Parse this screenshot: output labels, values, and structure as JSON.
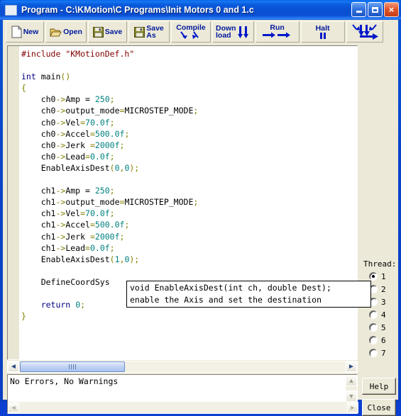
{
  "window": {
    "title": "Program - C:\\KMotion\\C Programs\\Init Motors 0 and 1.c",
    "icon": "document-icon",
    "caption": {
      "minimize": "minimize-icon",
      "maximize": "maximize-icon",
      "close": "×"
    }
  },
  "toolbar": {
    "buttons": [
      {
        "name": "new",
        "label": "New",
        "icon": "page-icon"
      },
      {
        "name": "open",
        "label": "Open",
        "icon": "folder-open-icon"
      },
      {
        "name": "save",
        "label": "Save",
        "icon": "floppy-icon"
      },
      {
        "name": "save-as",
        "label": "Save\nAs",
        "icon": "floppy-icon"
      },
      {
        "name": "compile",
        "label": "Compile",
        "icon": "two-arrows-down-icon"
      },
      {
        "name": "download",
        "label": "Down\nload",
        "icon": "arrow-down-icon"
      },
      {
        "name": "run",
        "label": "Run",
        "icon": "two-arrows-right-icon"
      },
      {
        "name": "halt",
        "label": "Halt",
        "icon": "pause-icon"
      },
      {
        "name": "compile-download-run",
        "label": "",
        "icon": "compile-download-run-icon"
      }
    ]
  },
  "editor": {
    "lines": [
      [
        {
          "t": "#include ",
          "c": "pre"
        },
        {
          "t": "\"KMotionDef.h\"",
          "c": "str"
        }
      ],
      [
        {
          "t": "",
          "c": "pln"
        }
      ],
      [
        {
          "t": "int",
          "c": "kw"
        },
        {
          "t": " main",
          "c": "pln"
        },
        {
          "t": "()",
          "c": "op"
        }
      ],
      [
        {
          "t": "{",
          "c": "op"
        }
      ],
      [
        {
          "t": "    ch0",
          "c": "pln"
        },
        {
          "t": "->",
          "c": "op"
        },
        {
          "t": "Amp = ",
          "c": "pln"
        },
        {
          "t": "250",
          "c": "num"
        },
        {
          "t": ";",
          "c": "op"
        }
      ],
      [
        {
          "t": "    ch0",
          "c": "pln"
        },
        {
          "t": "->",
          "c": "op"
        },
        {
          "t": "output_mode",
          "c": "pln"
        },
        {
          "t": "=",
          "c": "op"
        },
        {
          "t": "MICROSTEP_MODE",
          "c": "pln"
        },
        {
          "t": ";",
          "c": "op"
        }
      ],
      [
        {
          "t": "    ch0",
          "c": "pln"
        },
        {
          "t": "->",
          "c": "op"
        },
        {
          "t": "Vel",
          "c": "pln"
        },
        {
          "t": "=",
          "c": "op"
        },
        {
          "t": "70.0f",
          "c": "num"
        },
        {
          "t": ";",
          "c": "op"
        }
      ],
      [
        {
          "t": "    ch0",
          "c": "pln"
        },
        {
          "t": "->",
          "c": "op"
        },
        {
          "t": "Accel",
          "c": "pln"
        },
        {
          "t": "=",
          "c": "op"
        },
        {
          "t": "500.0f",
          "c": "num"
        },
        {
          "t": ";",
          "c": "op"
        }
      ],
      [
        {
          "t": "    ch0",
          "c": "pln"
        },
        {
          "t": "->",
          "c": "op"
        },
        {
          "t": "Jerk ",
          "c": "pln"
        },
        {
          "t": "=",
          "c": "op"
        },
        {
          "t": "2000f",
          "c": "num"
        },
        {
          "t": ";",
          "c": "op"
        }
      ],
      [
        {
          "t": "    ch0",
          "c": "pln"
        },
        {
          "t": "->",
          "c": "op"
        },
        {
          "t": "Lead",
          "c": "pln"
        },
        {
          "t": "=",
          "c": "op"
        },
        {
          "t": "0.0f",
          "c": "num"
        },
        {
          "t": ";",
          "c": "op"
        }
      ],
      [
        {
          "t": "    EnableAxisDest",
          "c": "pln"
        },
        {
          "t": "(",
          "c": "op"
        },
        {
          "t": "0",
          "c": "num"
        },
        {
          "t": ",",
          "c": "op"
        },
        {
          "t": "0",
          "c": "num"
        },
        {
          "t": ");",
          "c": "op"
        }
      ],
      [
        {
          "t": "",
          "c": "pln"
        }
      ],
      [
        {
          "t": "    ch1",
          "c": "pln"
        },
        {
          "t": "->",
          "c": "op"
        },
        {
          "t": "Amp = ",
          "c": "pln"
        },
        {
          "t": "250",
          "c": "num"
        },
        {
          "t": ";",
          "c": "op"
        }
      ],
      [
        {
          "t": "    ch1",
          "c": "pln"
        },
        {
          "t": "->",
          "c": "op"
        },
        {
          "t": "output_mode",
          "c": "pln"
        },
        {
          "t": "=",
          "c": "op"
        },
        {
          "t": "MICROSTEP_MODE",
          "c": "pln"
        },
        {
          "t": ";",
          "c": "op"
        }
      ],
      [
        {
          "t": "    ch1",
          "c": "pln"
        },
        {
          "t": "->",
          "c": "op"
        },
        {
          "t": "Vel",
          "c": "pln"
        },
        {
          "t": "=",
          "c": "op"
        },
        {
          "t": "70.0f",
          "c": "num"
        },
        {
          "t": ";",
          "c": "op"
        }
      ],
      [
        {
          "t": "    ch1",
          "c": "pln"
        },
        {
          "t": "->",
          "c": "op"
        },
        {
          "t": "Accel",
          "c": "pln"
        },
        {
          "t": "=",
          "c": "op"
        },
        {
          "t": "500.0f",
          "c": "num"
        },
        {
          "t": ";",
          "c": "op"
        }
      ],
      [
        {
          "t": "    ch1",
          "c": "pln"
        },
        {
          "t": "->",
          "c": "op"
        },
        {
          "t": "Jerk ",
          "c": "pln"
        },
        {
          "t": "=",
          "c": "op"
        },
        {
          "t": "2000f",
          "c": "num"
        },
        {
          "t": ";",
          "c": "op"
        }
      ],
      [
        {
          "t": "    ch1",
          "c": "pln"
        },
        {
          "t": "->",
          "c": "op"
        },
        {
          "t": "Lead",
          "c": "pln"
        },
        {
          "t": "=",
          "c": "op"
        },
        {
          "t": "0.0f",
          "c": "num"
        },
        {
          "t": ";",
          "c": "op"
        }
      ],
      [
        {
          "t": "    EnableAxisDest",
          "c": "pln"
        },
        {
          "t": "(",
          "c": "op"
        },
        {
          "t": "1",
          "c": "num"
        },
        {
          "t": ",",
          "c": "op"
        },
        {
          "t": "0",
          "c": "num"
        },
        {
          "t": ");",
          "c": "op"
        }
      ],
      [
        {
          "t": "",
          "c": "pln"
        }
      ],
      [
        {
          "t": "    DefineCoordSys",
          "c": "pln"
        }
      ],
      [
        {
          "t": "",
          "c": "pln"
        }
      ],
      [
        {
          "t": "    return",
          "c": "kw"
        },
        {
          "t": " ",
          "c": "pln"
        },
        {
          "t": "0",
          "c": "num"
        },
        {
          "t": ";",
          "c": "op"
        }
      ],
      [
        {
          "t": "}",
          "c": "op"
        }
      ]
    ]
  },
  "tooltip": {
    "signature": "void EnableAxisDest(int ch, double Dest);",
    "description": "enable the Axis and set the destination"
  },
  "thread": {
    "label": "Thread:",
    "options": [
      "1",
      "2",
      "3",
      "4",
      "5",
      "6",
      "7"
    ],
    "selected": "1"
  },
  "scrollbar": {
    "left_arrow": "◄",
    "right_arrow": "►",
    "up_arrow": "▲",
    "down_arrow": "▼"
  },
  "status": {
    "text": "No Errors, No Warnings"
  },
  "buttons": {
    "help": "Help",
    "close": "Close"
  },
  "colors": {
    "title_bar": "#0a50d4",
    "face": "#ece9d8",
    "toolbar_label": "#00189c",
    "keyword": "#00007f",
    "number": "#008080",
    "operator": "#808000",
    "preprocessor": "#7f0000",
    "close_button": "#e2562c"
  }
}
